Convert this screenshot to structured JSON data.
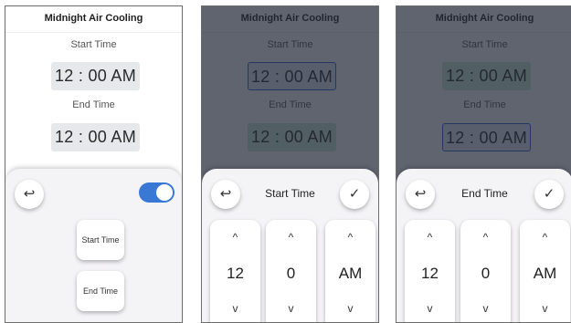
{
  "app_title": "Midnight Air Cooling",
  "labels": {
    "start_time": "Start Time",
    "end_time": "End Time"
  },
  "times": {
    "start": "12 : 00 AM",
    "end": "12 : 00 AM"
  },
  "settings_sheet": {
    "start_button": "Start Time",
    "end_button": "End Time",
    "toggle_on": true
  },
  "picker_start": {
    "title": "Start Time",
    "hour": "12",
    "minute": "0",
    "period": "AM"
  },
  "picker_end": {
    "title": "End Time",
    "hour": "12",
    "minute": "0",
    "period": "AM"
  },
  "icons": {
    "back": "↩",
    "confirm": "✓",
    "up": "^",
    "down": "v"
  },
  "colors": {
    "toggle_on": "#3a78d6",
    "selected_border": "#2f5fd2",
    "selected_fill": "#c9e8d6"
  }
}
